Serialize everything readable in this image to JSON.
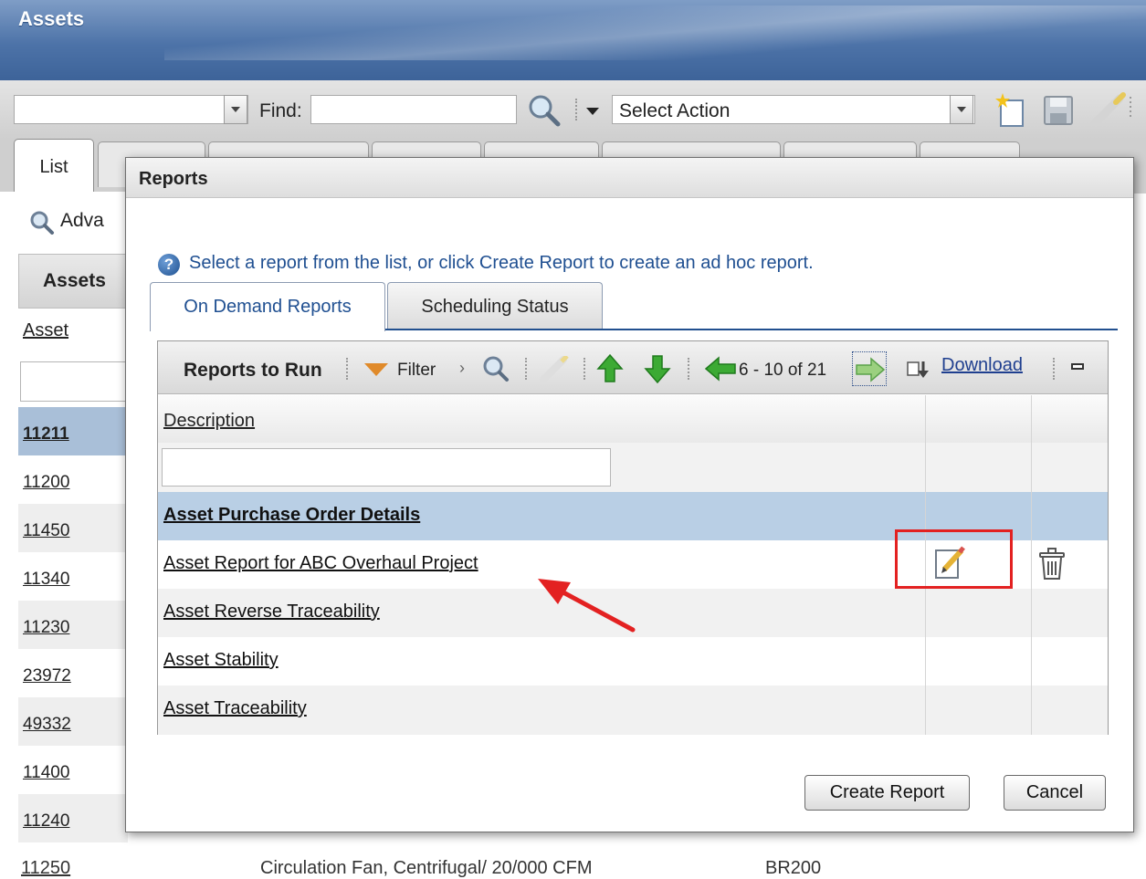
{
  "app": {
    "title": "Assets"
  },
  "toolbar": {
    "find_label": "Find:",
    "find_value": "",
    "select_action": "Select Action"
  },
  "main_tabs": {
    "list_label": "List"
  },
  "sidebar": {
    "advanced_label": "Adva",
    "assets_header": "Assets",
    "asset_column_label": "Asset",
    "asset_filter_value": "",
    "rows": [
      "11211",
      "11200",
      "11450",
      "11340",
      "11230",
      "23972",
      "49332",
      "11400",
      "11240",
      "11250"
    ]
  },
  "background_row": {
    "description": "Circulation Fan, Centrifugal/ 20/000 CFM",
    "code": "BR200"
  },
  "dialog": {
    "title": "Reports",
    "info_text": "Select a report from the list, or click Create Report to create an ad hoc report.",
    "tabs": [
      {
        "label": "On Demand Reports"
      },
      {
        "label": "Scheduling Status"
      }
    ],
    "grid": {
      "toolbar_title": "Reports to Run",
      "filter_label": "Filter",
      "paging": "6 - 10 of 21",
      "download_label": "Download",
      "column_description": "Description",
      "filter_value": "",
      "rows": [
        {
          "description": "Asset Purchase Order Details"
        },
        {
          "description": "Asset Report for ABC Overhaul Project"
        },
        {
          "description": "Asset Reverse Traceability"
        },
        {
          "description": "Asset Stability"
        },
        {
          "description": "Asset Traceability"
        }
      ]
    },
    "buttons": {
      "create_report": "Create Report",
      "cancel": "Cancel"
    }
  },
  "colors": {
    "header_blue": "#4d73a8",
    "selected_row": "#b9cfe5",
    "accent_link": "#1f4f91",
    "highlight_red": "#e32121"
  }
}
